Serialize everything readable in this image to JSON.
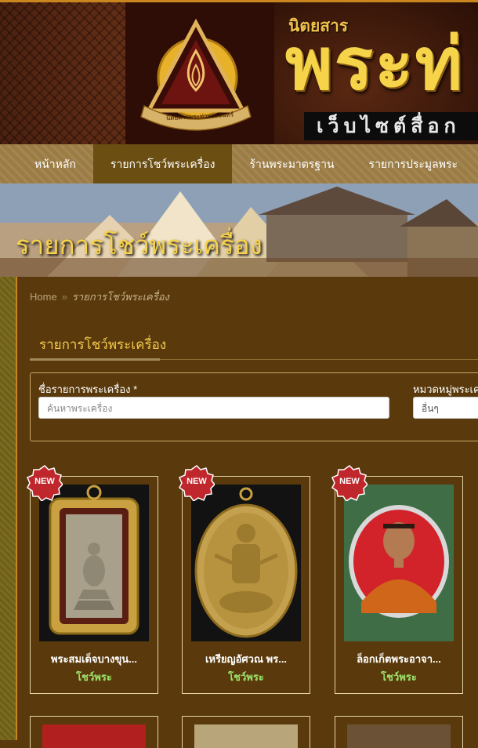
{
  "header": {
    "magazine_label": "นิตยสาร",
    "title": "พระท่",
    "website_strip": "เว็บไซต์สื่อก",
    "logo_ribbon": "นิตยสารพระท่าพระจันทร์"
  },
  "nav": {
    "items": [
      {
        "label": "หน้าหลัก",
        "active": false
      },
      {
        "label": "รายการโชว์พระเครื่อง",
        "active": true
      },
      {
        "label": "ร้านพระมาตรฐาน",
        "active": false
      },
      {
        "label": "รายการประมูลพระ",
        "active": false
      }
    ]
  },
  "hero": {
    "title": "รายการโชว์พระเครื่อง"
  },
  "breadcrumb": {
    "home": "Home",
    "separator": "»",
    "current": "รายการโชว์พระเครื่อง"
  },
  "section": {
    "title": "รายการโชว์พระเครื่อง"
  },
  "filter": {
    "name_label": "ชื่อรายการพระเครื่อง *",
    "name_placeholder": "ค้นหาพระเครื่อง",
    "category_label": "หมวดหมู่พระเค",
    "category_value": "อื่นๆ"
  },
  "badge_text": "NEW",
  "products": [
    {
      "name": "พระสมเด็จบางขุน...",
      "category": "โชว์พระ"
    },
    {
      "name": "เหรียญอัศวณ พร...",
      "category": "โชว์พระ"
    },
    {
      "name": "ล็อกเก็ตพระอาจา...",
      "category": "โชว์พระ"
    }
  ],
  "colors": {
    "accent_gold": "#f3c94d",
    "category_green": "#9be46b",
    "nav_bg": "#9b7c44",
    "nav_active": "#6b4e12",
    "content_bg": "#5a3a0c",
    "badge_red": "#c0272d"
  }
}
